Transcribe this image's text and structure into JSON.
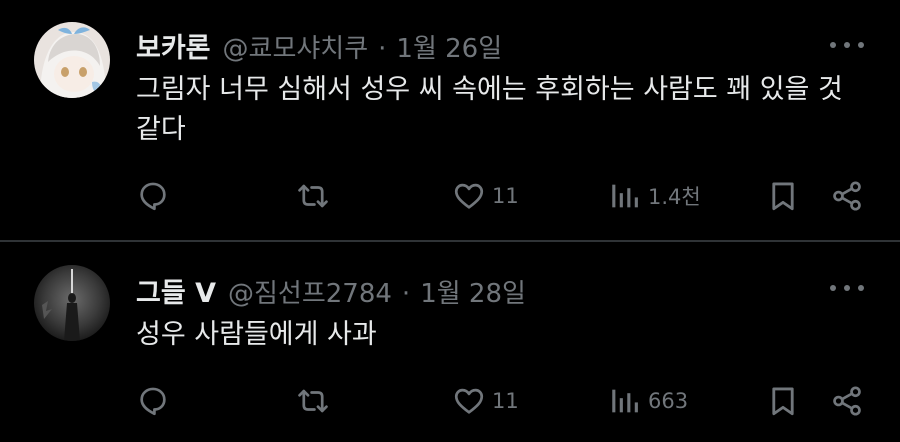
{
  "posts": [
    {
      "author": "보카론",
      "handle": "@쿄모샤치쿠",
      "separator": "·",
      "date": "1월 26일",
      "text": "그림자 너무 심해서 성우 씨 속에는 후회하는 사람도 꽤 있을 것 같다",
      "likes": "11",
      "views": "1.4천"
    },
    {
      "author": "그들 V",
      "handle": "@짐선프2784",
      "separator": "·",
      "date": "1월 28일",
      "text": "성우 사람들에게 사과",
      "likes": "11",
      "views": "663"
    }
  ],
  "icons": [
    "reply-icon",
    "repost-icon",
    "like-icon",
    "views-icon",
    "bookmark-icon",
    "share-icon",
    "more-icon"
  ],
  "colors": {
    "background": "#000000",
    "text": "#e7e9ea",
    "muted": "#71767b",
    "divider": "#2f3336"
  }
}
